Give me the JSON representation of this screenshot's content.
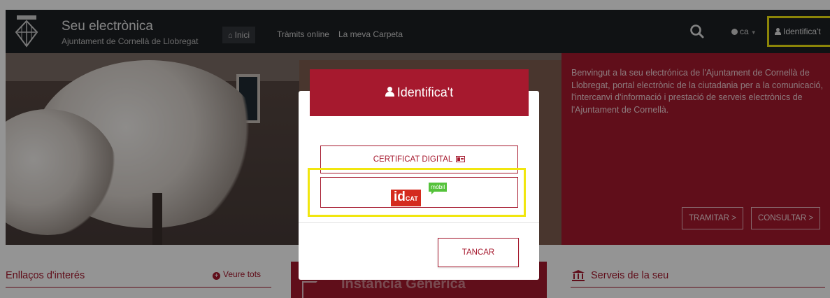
{
  "navbar": {
    "title": "Seu electrònica",
    "subtitle": "Ajuntament de Cornellà de Llobregat",
    "links": {
      "home": "Inici",
      "tramits": "Tràmits online",
      "carpeta": "La meva Carpeta"
    },
    "language": "ca",
    "identify": "Identifica't",
    "icons": {
      "logo": "municipal-coat-of-arms-icon",
      "home": "home-icon",
      "search": "search-icon",
      "globe": "globe-icon",
      "user": "user-icon"
    }
  },
  "welcome": {
    "text": "Benvingut a la seu electrónica de l'Ajuntament de Cornellà de Llobregat, portal electrònic de la ciutadania per a la comunicació, l'intercanvi d'informació i prestació de serveis electrònics de l'Ajuntament de Cornellà.",
    "buttons": {
      "tramitar": "TRAMITAR >",
      "consultar": "CONSULTAR >"
    }
  },
  "bottom": {
    "links_title": "Enllaços d'interés",
    "links_more": "Veure tots",
    "instancia_title": "Instància Genèrica",
    "serveis_title": "Serveis de la seu"
  },
  "modal": {
    "title": "Identifica't",
    "cert_button": "CERTIFICAT DIGITAL",
    "idcat": {
      "main": "id",
      "cat": "CAT",
      "mobil": "mòbil"
    },
    "close_button": "TANCAR"
  },
  "colors": {
    "brand_red": "#a6192e",
    "navbar_bg": "#1c1f24",
    "highlight_yellow": "#f1e60e",
    "idcat_red": "#d42b1e",
    "idcat_green": "#54c23a"
  }
}
